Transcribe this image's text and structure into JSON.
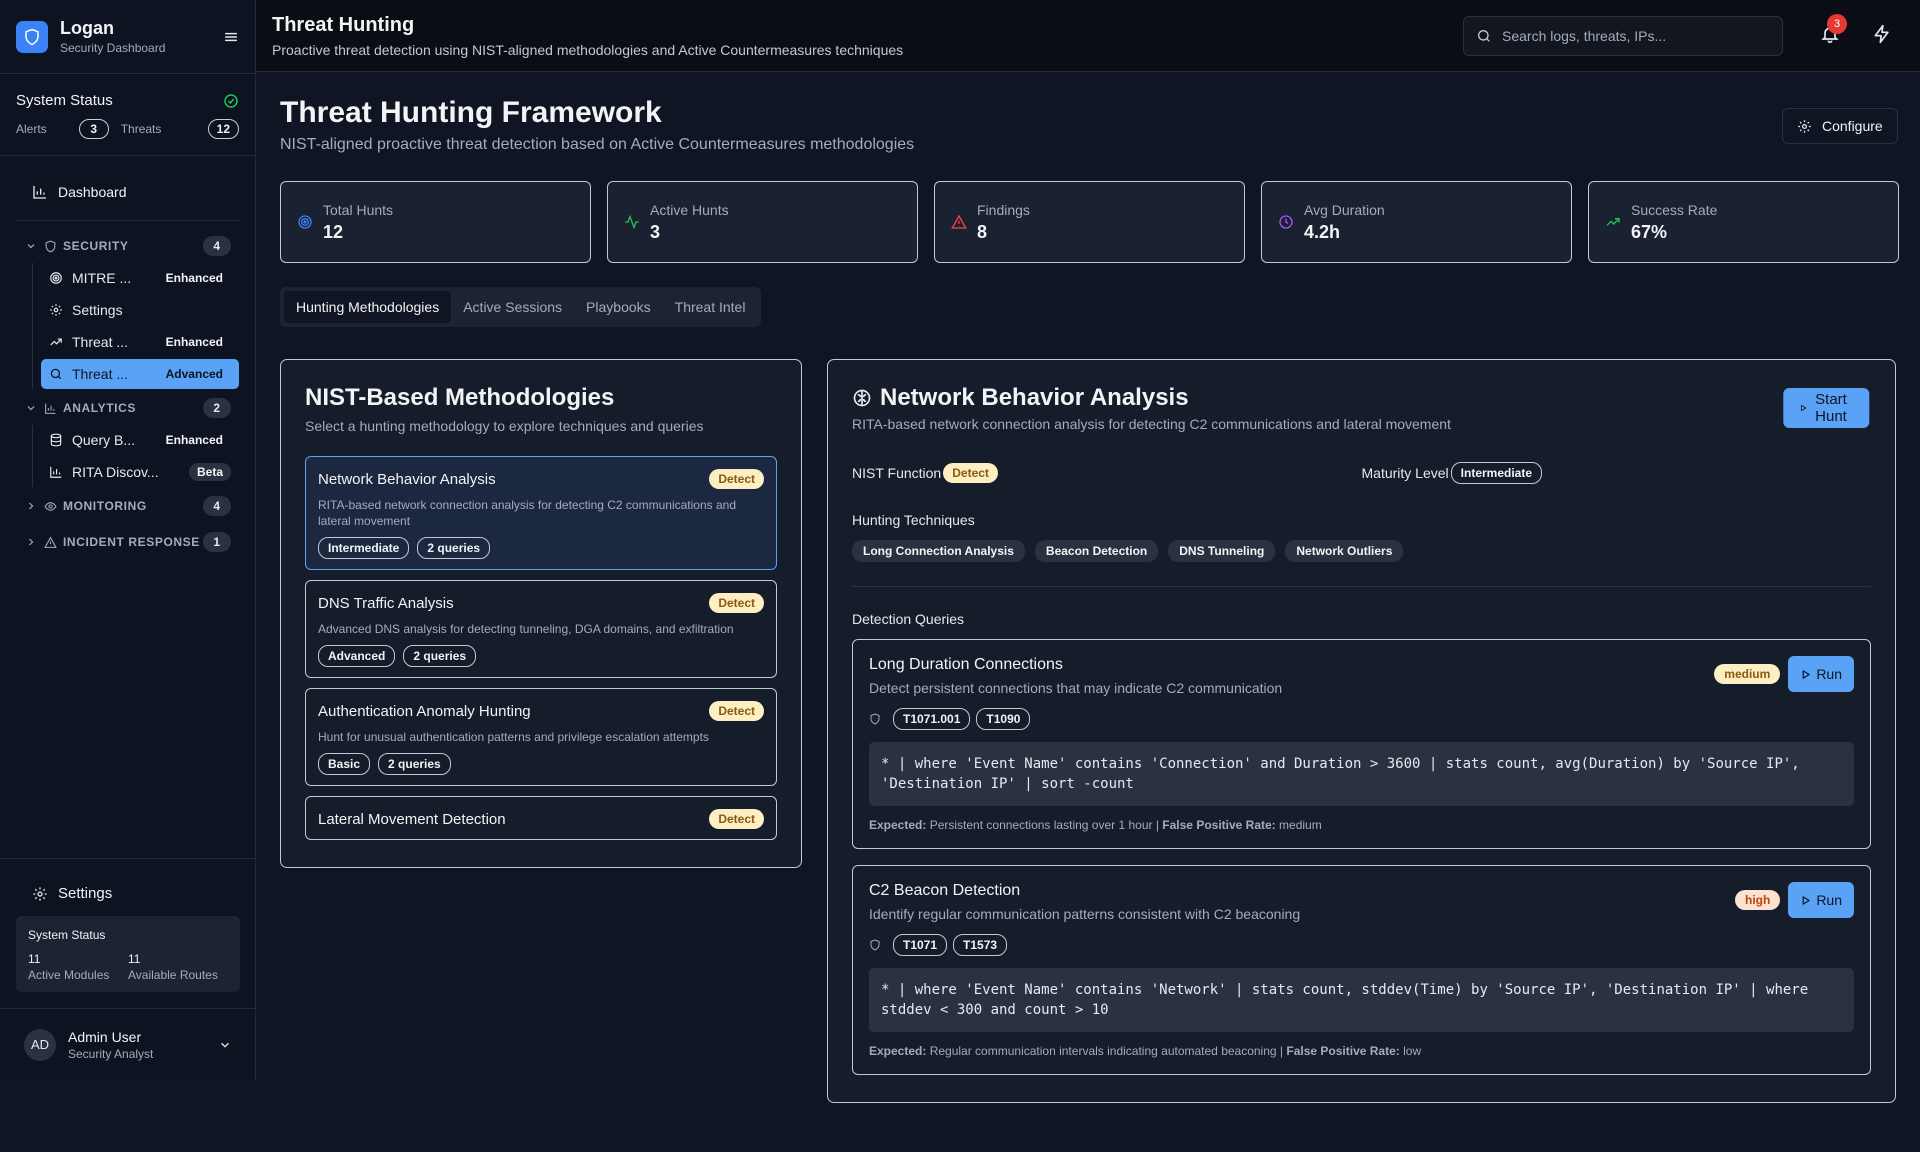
{
  "brand": {
    "name": "Logan",
    "subtitle": "Security Dashboard"
  },
  "system_status": {
    "title": "System Status",
    "alerts_label": "Alerts",
    "alerts_count": "3",
    "threats_label": "Threats",
    "threats_count": "12"
  },
  "nav": {
    "dashboard": "Dashboard",
    "groups": [
      {
        "label": "SECURITY",
        "count": "4",
        "expanded": true,
        "items": [
          {
            "label": "MITRE ...",
            "tag": "Enhanced",
            "icon": "target-icon"
          },
          {
            "label": "Settings",
            "tag": "",
            "icon": "gear-icon"
          },
          {
            "label": "Threat ...",
            "tag": "Enhanced",
            "icon": "trending-up-icon"
          },
          {
            "label": "Threat ...",
            "tag": "Advanced",
            "icon": "search-icon",
            "active": true
          }
        ]
      },
      {
        "label": "ANALYTICS",
        "count": "2",
        "expanded": true,
        "items": [
          {
            "label": "Query B...",
            "tag": "Enhanced",
            "icon": "database-icon"
          },
          {
            "label": "RITA Discov...",
            "tag": "Beta",
            "icon": "bar-chart-icon"
          }
        ]
      },
      {
        "label": "MONITORING",
        "count": "4",
        "expanded": false
      },
      {
        "label": "INCIDENT RESPONSE",
        "count": "1",
        "expanded": false
      }
    ]
  },
  "sidebar_bottom": {
    "settings": "Settings",
    "status_title": "System Status",
    "active_modules_value": "11",
    "active_modules_label": "Active Modules",
    "routes_value": "11",
    "routes_label": "Available Routes"
  },
  "user": {
    "initials": "AD",
    "name": "Admin User",
    "role": "Security Analyst"
  },
  "header": {
    "title": "Threat Hunting",
    "subtitle": "Proactive threat detection using NIST-aligned methodologies and Active Countermeasures techniques",
    "search_placeholder": "Search logs, threats, IPs...",
    "notification_count": "3"
  },
  "page": {
    "title": "Threat Hunting Framework",
    "subtitle": "NIST-aligned proactive threat detection based on Active Countermeasures methodologies",
    "configure": "Configure"
  },
  "stats": [
    {
      "label": "Total Hunts",
      "value": "12",
      "icon": "target-icon",
      "color": "#3b82f6"
    },
    {
      "label": "Active Hunts",
      "value": "3",
      "icon": "activity-icon",
      "color": "#22c55e"
    },
    {
      "label": "Findings",
      "value": "8",
      "icon": "alert-triangle-icon",
      "color": "#ef4444"
    },
    {
      "label": "Avg Duration",
      "value": "4.2h",
      "icon": "clock-icon",
      "color": "#a855f7"
    },
    {
      "label": "Success Rate",
      "value": "67%",
      "icon": "trending-up-icon",
      "color": "#22c55e"
    }
  ],
  "tabs": [
    "Hunting Methodologies",
    "Active Sessions",
    "Playbooks",
    "Threat Intel"
  ],
  "methodologies": {
    "title": "NIST-Based Methodologies",
    "subtitle": "Select a hunting methodology to explore techniques and queries",
    "items": [
      {
        "name": "Network Behavior Analysis",
        "badge": "Detect",
        "desc": "RITA-based network connection analysis for detecting C2 communications and lateral movement",
        "level": "Intermediate",
        "queries": "2 queries"
      },
      {
        "name": "DNS Traffic Analysis",
        "badge": "Detect",
        "desc": "Advanced DNS analysis for detecting tunneling, DGA domains, and exfiltration",
        "level": "Advanced",
        "queries": "2 queries"
      },
      {
        "name": "Authentication Anomaly Hunting",
        "badge": "Detect",
        "desc": "Hunt for unusual authentication patterns and privilege escalation attempts",
        "level": "Basic",
        "queries": "2 queries"
      },
      {
        "name": "Lateral Movement Detection",
        "badge": "Detect",
        "desc": "",
        "level": "",
        "queries": ""
      }
    ]
  },
  "detail": {
    "title": "Network Behavior Analysis",
    "subtitle": "RITA-based network connection analysis for detecting C2 communications and lateral movement",
    "start_hunt": "Start Hunt",
    "nist_label": "NIST Function",
    "nist_value": "Detect",
    "maturity_label": "Maturity Level",
    "maturity_value": "Intermediate",
    "techniques_label": "Hunting Techniques",
    "techniques": [
      "Long Connection Analysis",
      "Beacon Detection",
      "DNS Tunneling",
      "Network Outliers"
    ],
    "queries_label": "Detection Queries",
    "queries": [
      {
        "title": "Long Duration Connections",
        "desc": "Detect persistent connections that may indicate C2 communication",
        "severity": "medium",
        "run": "Run",
        "mitre": [
          "T1071.001",
          "T1090"
        ],
        "code": "* | where 'Event Name' contains 'Connection' and Duration > 3600 | stats count, avg(Duration) by 'Source IP', 'Destination IP' | sort -count",
        "expected_label": "Expected:",
        "expected": "Persistent connections lasting over 1 hour",
        "fp_label": "False Positive Rate:",
        "fp": "medium"
      },
      {
        "title": "C2 Beacon Detection",
        "desc": "Identify regular communication patterns consistent with C2 beaconing",
        "severity": "high",
        "run": "Run",
        "mitre": [
          "T1071",
          "T1573"
        ],
        "code": "* | where 'Event Name' contains 'Network' | stats count, stddev(Time) by 'Source IP', 'Destination IP' | where stddev < 300 and count > 10",
        "expected_label": "Expected:",
        "expected": "Regular communication intervals indicating automated beaconing",
        "fp_label": "False Positive Rate:",
        "fp": "low"
      }
    ]
  }
}
